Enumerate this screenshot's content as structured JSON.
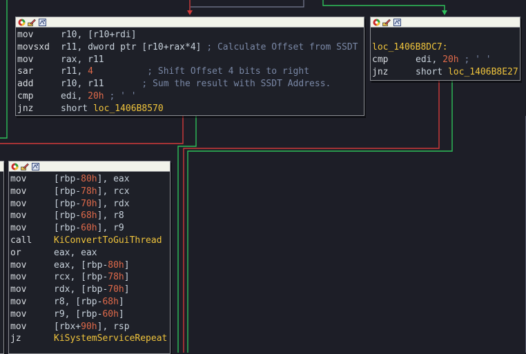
{
  "colors": {
    "background": "#1d1e27",
    "block_bg": "#1e2028",
    "edge_red": "#d13a3a",
    "edge_green": "#2ec05a",
    "edge_blue": "#7a7f95",
    "label": "#f0c43c",
    "number": "#e06a4a",
    "comment": "#7a88a6"
  },
  "titlebar_icons": [
    "color-icon",
    "rename-icon",
    "graph-icon"
  ],
  "block_top": {
    "lines": [
      {
        "mn": "mov",
        "ops": [
          {
            "t": "r10, ["
          },
          {
            "t": "r10+rdi"
          },
          {
            "t": "]"
          }
        ]
      },
      {
        "mn": "movsxd",
        "ops": [
          {
            "t": "r11, dword ptr [r10+rax*4]"
          },
          {
            "t": " ; Calculate Offset from SSDT",
            "c": "cmt"
          }
        ]
      },
      {
        "mn": "mov",
        "ops": [
          {
            "t": "rax, r11"
          }
        ]
      },
      {
        "mn": "sar",
        "ops": [
          {
            "t": "r11, "
          },
          {
            "t": "4",
            "c": "num"
          },
          {
            "t": "          ; Shift Offset 4 bits to right",
            "c": "cmt"
          }
        ]
      },
      {
        "mn": "add",
        "ops": [
          {
            "t": "r10, r11"
          },
          {
            "t": "       ; Sum the result with SSDT Address.",
            "c": "cmt"
          }
        ]
      },
      {
        "mn": "cmp",
        "ops": [
          {
            "t": "edi, "
          },
          {
            "t": "20h",
            "c": "num"
          },
          {
            "t": " ; ' '",
            "c": "cmt"
          }
        ]
      },
      {
        "mn": "jnz",
        "ops": [
          {
            "t": "short "
          },
          {
            "t": "loc_1406B8570",
            "c": "lbl"
          }
        ]
      }
    ]
  },
  "block_right": {
    "label": "loc_1406B8DC7:",
    "lines": [
      {
        "mn": "cmp",
        "ops": [
          {
            "t": "edi, "
          },
          {
            "t": "20h",
            "c": "num"
          },
          {
            "t": " ; ' '",
            "c": "cmt"
          }
        ]
      },
      {
        "mn": "jnz",
        "ops": [
          {
            "t": "short "
          },
          {
            "t": "loc_1406B8E27",
            "c": "lbl"
          }
        ]
      }
    ]
  },
  "block_main": {
    "lines": [
      {
        "mn": "mov",
        "ops": [
          {
            "t": "["
          },
          {
            "t": "rbp-"
          },
          {
            "t": "80h",
            "c": "num"
          },
          {
            "t": "], eax"
          }
        ]
      },
      {
        "mn": "mov",
        "ops": [
          {
            "t": "["
          },
          {
            "t": "rbp-"
          },
          {
            "t": "78h",
            "c": "num"
          },
          {
            "t": "], rcx"
          }
        ]
      },
      {
        "mn": "mov",
        "ops": [
          {
            "t": "["
          },
          {
            "t": "rbp-"
          },
          {
            "t": "70h",
            "c": "num"
          },
          {
            "t": "], rdx"
          }
        ]
      },
      {
        "mn": "mov",
        "ops": [
          {
            "t": "["
          },
          {
            "t": "rbp-"
          },
          {
            "t": "68h",
            "c": "num"
          },
          {
            "t": "], r8"
          }
        ]
      },
      {
        "mn": "mov",
        "ops": [
          {
            "t": "["
          },
          {
            "t": "rbp-"
          },
          {
            "t": "60h",
            "c": "num"
          },
          {
            "t": "], r9"
          }
        ]
      },
      {
        "mn": "call",
        "ops": [
          {
            "t": "KiConvertToGuiThread",
            "c": "lbl"
          }
        ]
      },
      {
        "mn": "or",
        "ops": [
          {
            "t": "eax, eax"
          }
        ]
      },
      {
        "mn": "mov",
        "ops": [
          {
            "t": "eax, [rbp-"
          },
          {
            "t": "80h",
            "c": "num"
          },
          {
            "t": "]"
          }
        ]
      },
      {
        "mn": "mov",
        "ops": [
          {
            "t": "rcx, [rbp-"
          },
          {
            "t": "78h",
            "c": "num"
          },
          {
            "t": "]"
          }
        ]
      },
      {
        "mn": "mov",
        "ops": [
          {
            "t": "rdx, [rbp-"
          },
          {
            "t": "70h",
            "c": "num"
          },
          {
            "t": "]"
          }
        ]
      },
      {
        "mn": "mov",
        "ops": [
          {
            "t": "r8, [rbp-"
          },
          {
            "t": "68h",
            "c": "num"
          },
          {
            "t": "]"
          }
        ]
      },
      {
        "mn": "mov",
        "ops": [
          {
            "t": "r9, [rbp-"
          },
          {
            "t": "60h",
            "c": "num"
          },
          {
            "t": "]"
          }
        ]
      },
      {
        "mn": "mov",
        "ops": [
          {
            "t": "[rbx+"
          },
          {
            "t": "90h",
            "c": "num"
          },
          {
            "t": "], rsp"
          }
        ]
      },
      {
        "mn": "jz",
        "ops": [
          {
            "t": "KiSystemServiceRepeat",
            "c": "lbl"
          }
        ]
      }
    ]
  }
}
